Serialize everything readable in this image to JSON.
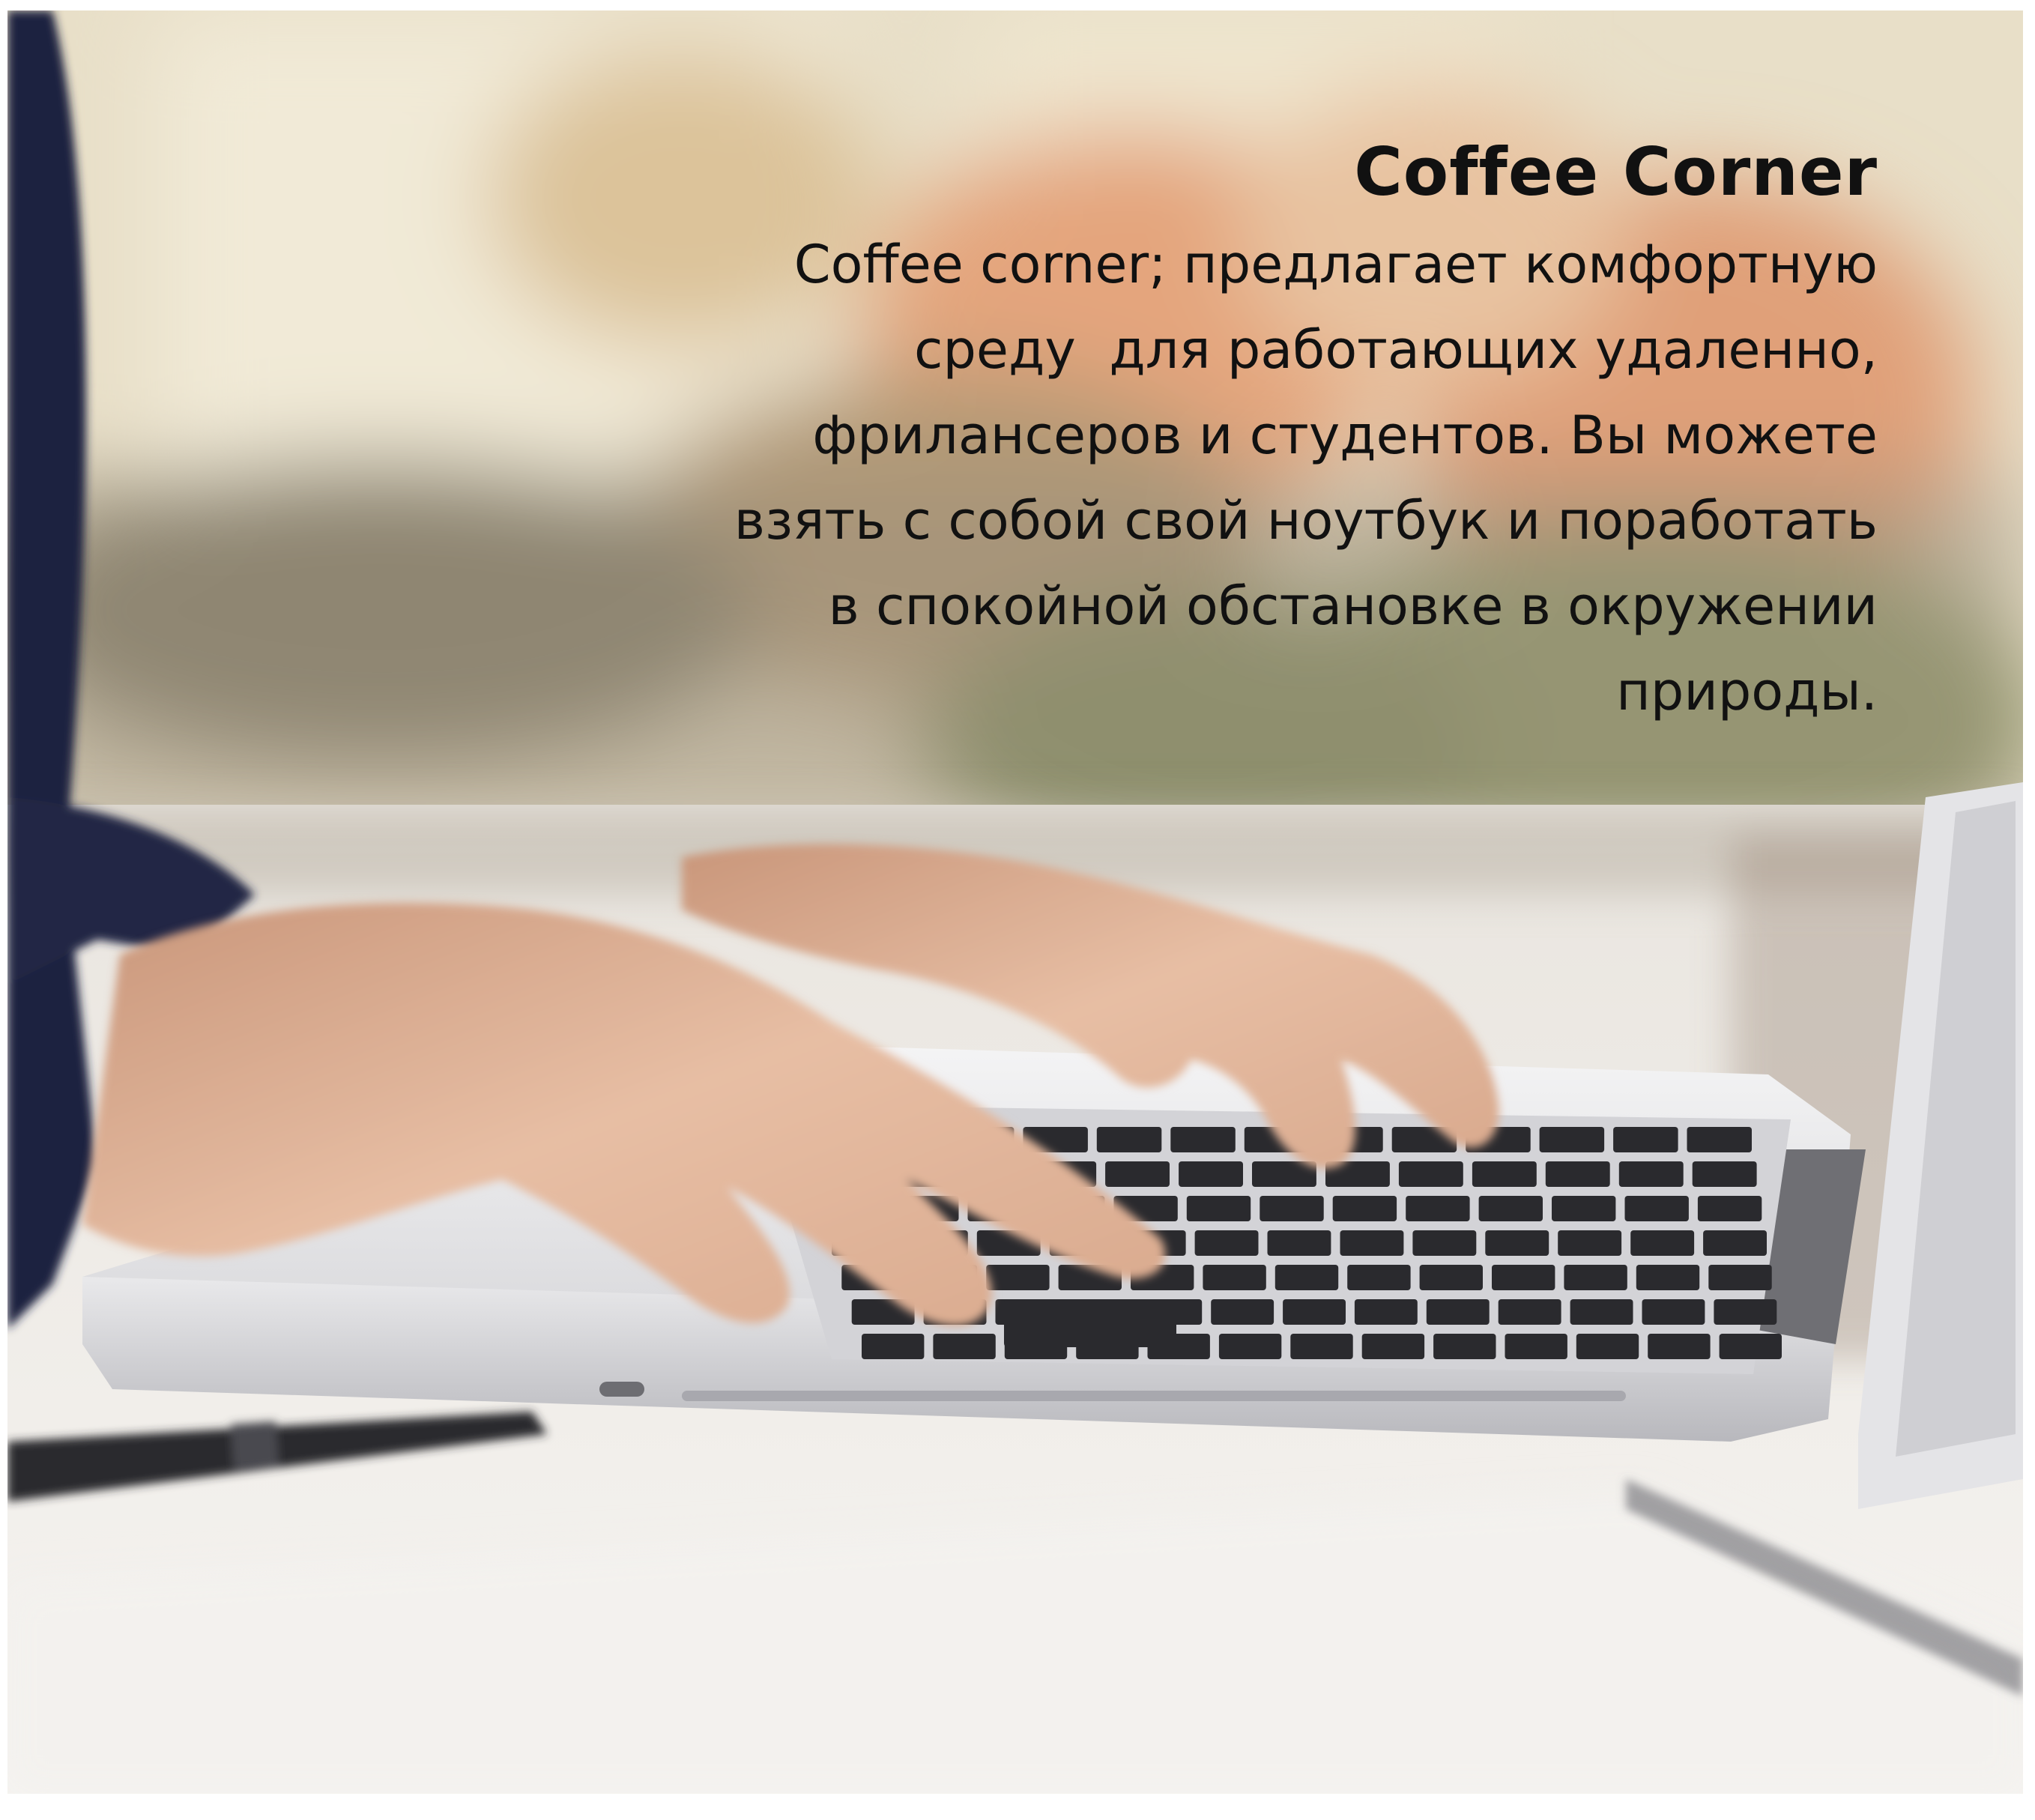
{
  "card": {
    "title": "Coffee Corner",
    "description_lines": [
      "Coffee corner; предлагает комфортную",
      "среду  для работающих удаленно,",
      "фрилансеров и студентов. Вы можете",
      "взять с собой свой ноутбук и поработать",
      "в спокойной обстановке в окружении",
      "природы."
    ]
  },
  "photo": {
    "subject": "laptop-typing-hands",
    "colors": {
      "background_warm": "#e9dcc0",
      "plants_orange": "#e2a27a",
      "plants_green": "#8a9a5e",
      "sleeve_navy": "#1f2440",
      "skin": "#e3b79c",
      "laptop_silver": "#e6e6e8",
      "keys_dark": "#2a2a2e",
      "table_light": "#efece8"
    }
  }
}
